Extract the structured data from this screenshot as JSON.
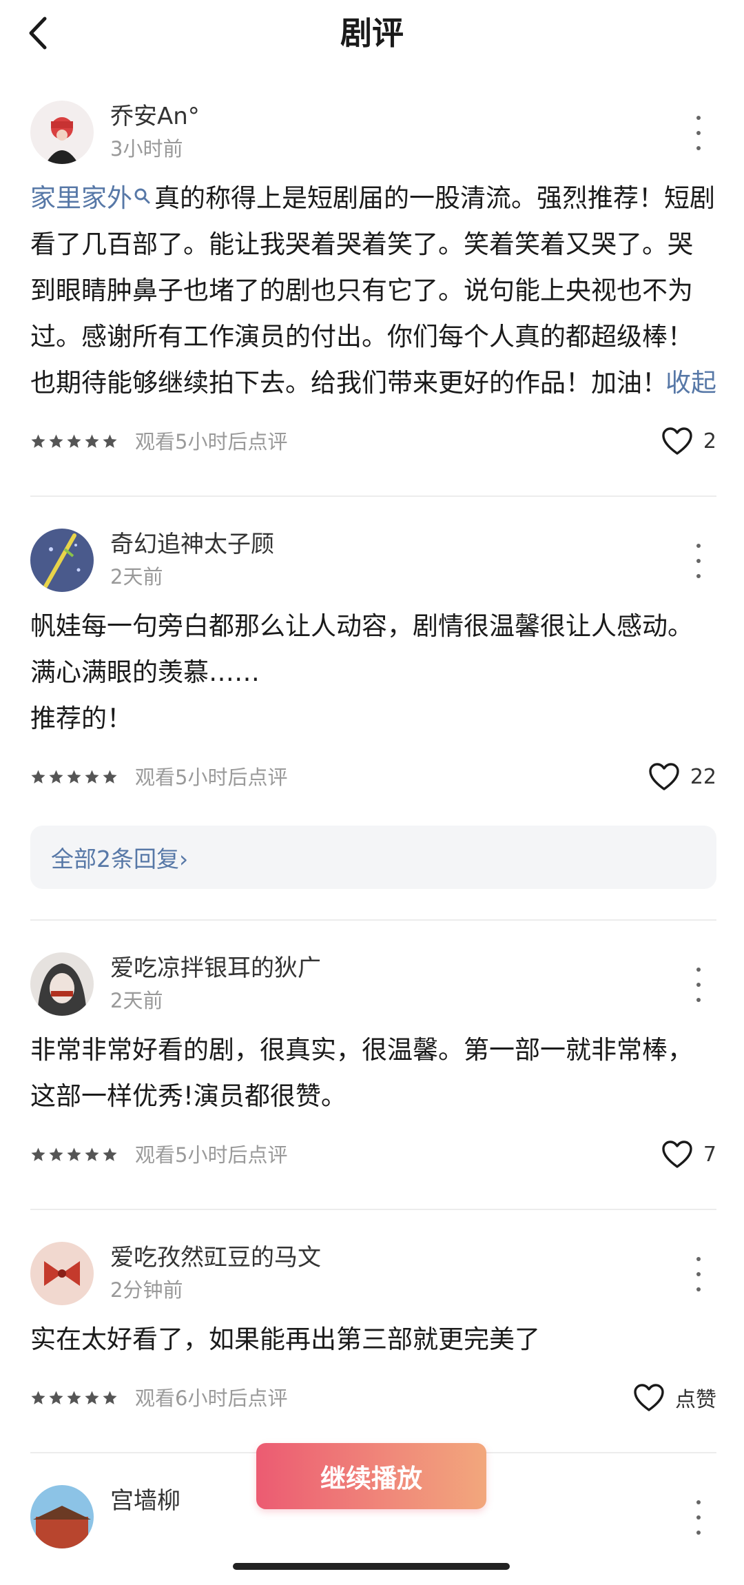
{
  "header": {
    "title": "剧评"
  },
  "reviews": [
    {
      "username": "乔安An°",
      "time": "3小时前",
      "tag": "家里家外",
      "content_lines": [
        "真的称得上是短剧届的一股清流。强烈推荐！短剧看了几百部了。能让我哭着哭着笑了。笑着笑着又哭了。哭到眼睛肿鼻子也堵了的剧也只有它了。说句能上央视也不为过。感谢所有工作演员的付出。你们每个人真的都超级棒！也期待能够继续拍下去。给我们带来更好的作品！加油！"
      ],
      "collapse_label": "收起",
      "rating": 5,
      "watch_note": "观看5小时后点评",
      "likes": "2"
    },
    {
      "username": "奇幻追神太子顾",
      "time": "2天前",
      "content_lines": [
        "帆娃每一句旁白都那么让人动容，剧情很温馨很让人感动。满心满眼的羡慕……",
        "推荐的！"
      ],
      "rating": 5,
      "watch_note": "观看5小时后点评",
      "likes": "22",
      "replies_label": "全部2条回复›"
    },
    {
      "username": "爱吃凉拌银耳的狄广",
      "time": "2天前",
      "content_lines": [
        "非常非常好看的剧，很真实，很温馨。第一部一就非常棒，这部一样优秀!演员都很赞。"
      ],
      "rating": 5,
      "watch_note": "观看5小时后点评",
      "likes": "7"
    },
    {
      "username": "爱吃孜然豇豆的马文",
      "time": "2分钟前",
      "content_lines": [
        "实在太好看了，如果能再出第三部就更完美了"
      ],
      "rating": 5,
      "watch_note": "观看6小时后点评",
      "likes": "点赞"
    },
    {
      "username": "宫墙柳"
    }
  ],
  "play_button": {
    "label": "继续播放"
  },
  "colors": {
    "link": "#5778a7",
    "play_gradient_start": "#ec5b72",
    "play_gradient_end": "#f2a77c"
  },
  "icons": {
    "back": "chevron-left-icon",
    "more": "vertical-dots-icon",
    "like": "heart-outline-icon",
    "star": "star-filled-icon",
    "search": "search-icon"
  }
}
